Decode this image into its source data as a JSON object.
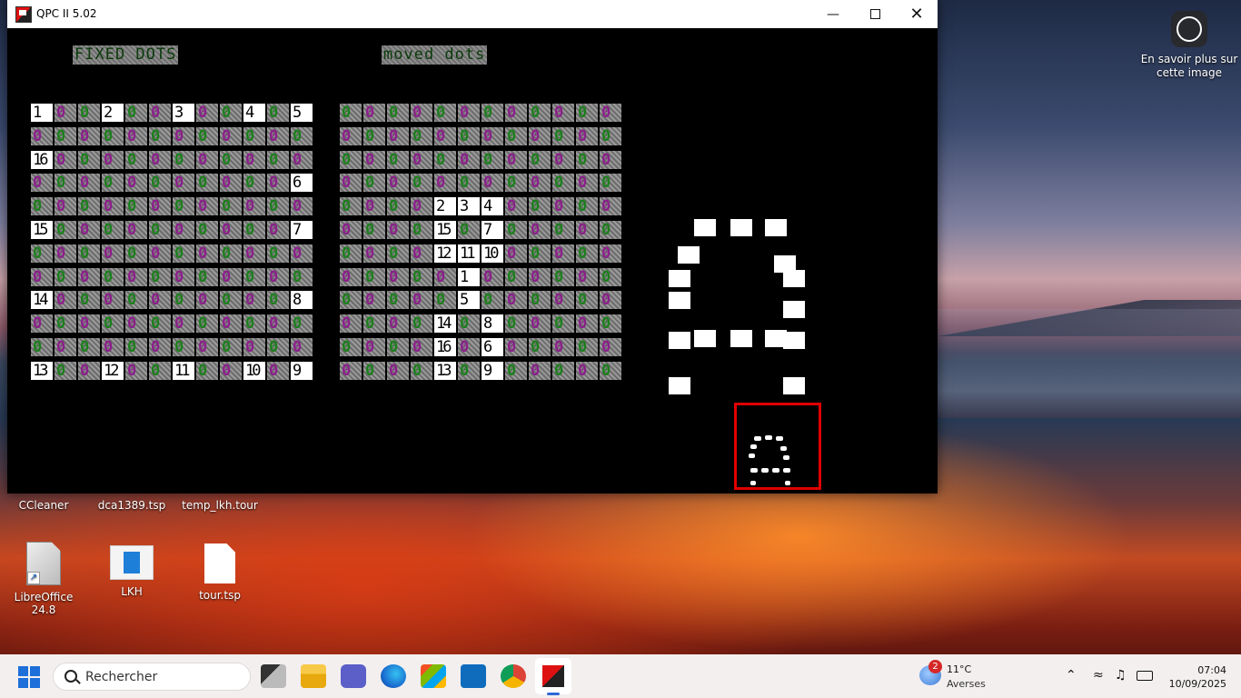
{
  "window": {
    "title": "QPC II 5.02"
  },
  "screen": {
    "left_title": "FIXED DOTS",
    "right_title": "moved dots",
    "fixed_grid": [
      [
        "1",
        "0",
        "0",
        "2",
        "0",
        "0",
        "3",
        "0",
        "0",
        "4",
        "0",
        "5"
      ],
      [
        "0",
        "0",
        "0",
        "0",
        "0",
        "0",
        "0",
        "0",
        "0",
        "0",
        "0",
        "0"
      ],
      [
        "16",
        "0",
        "0",
        "0",
        "0",
        "0",
        "0",
        "0",
        "0",
        "0",
        "0",
        "0"
      ],
      [
        "0",
        "0",
        "0",
        "0",
        "0",
        "0",
        "0",
        "0",
        "0",
        "0",
        "0",
        "6"
      ],
      [
        "0",
        "0",
        "0",
        "0",
        "0",
        "0",
        "0",
        "0",
        "0",
        "0",
        "0",
        "0"
      ],
      [
        "15",
        "0",
        "0",
        "0",
        "0",
        "0",
        "0",
        "0",
        "0",
        "0",
        "0",
        "7"
      ],
      [
        "0",
        "0",
        "0",
        "0",
        "0",
        "0",
        "0",
        "0",
        "0",
        "0",
        "0",
        "0"
      ],
      [
        "0",
        "0",
        "0",
        "0",
        "0",
        "0",
        "0",
        "0",
        "0",
        "0",
        "0",
        "0"
      ],
      [
        "14",
        "0",
        "0",
        "0",
        "0",
        "0",
        "0",
        "0",
        "0",
        "0",
        "0",
        "8"
      ],
      [
        "0",
        "0",
        "0",
        "0",
        "0",
        "0",
        "0",
        "0",
        "0",
        "0",
        "0",
        "0"
      ],
      [
        "0",
        "0",
        "0",
        "0",
        "0",
        "0",
        "0",
        "0",
        "0",
        "0",
        "0",
        "0"
      ],
      [
        "13",
        "0",
        "0",
        "12",
        "0",
        "0",
        "11",
        "0",
        "0",
        "10",
        "0",
        "9"
      ]
    ],
    "moved_grid": [
      [
        "0",
        "0",
        "0",
        "0",
        "0",
        "0",
        "0",
        "0",
        "0",
        "0",
        "0",
        "0"
      ],
      [
        "0",
        "0",
        "0",
        "0",
        "0",
        "0",
        "0",
        "0",
        "0",
        "0",
        "0",
        "0"
      ],
      [
        "0",
        "0",
        "0",
        "0",
        "0",
        "0",
        "0",
        "0",
        "0",
        "0",
        "0",
        "0"
      ],
      [
        "0",
        "0",
        "0",
        "0",
        "0",
        "0",
        "0",
        "0",
        "0",
        "0",
        "0",
        "0"
      ],
      [
        "0",
        "0",
        "0",
        "0",
        "2",
        "3",
        "4",
        "0",
        "0",
        "0",
        "0",
        "0"
      ],
      [
        "0",
        "0",
        "0",
        "0",
        "15",
        "0",
        "7",
        "0",
        "0",
        "0",
        "0",
        "0"
      ],
      [
        "0",
        "0",
        "0",
        "0",
        "12",
        "11",
        "10",
        "0",
        "0",
        "0",
        "0",
        "0"
      ],
      [
        "0",
        "0",
        "0",
        "0",
        "0",
        "1",
        "0",
        "0",
        "0",
        "0",
        "0",
        "0"
      ],
      [
        "0",
        "0",
        "0",
        "0",
        "0",
        "5",
        "0",
        "0",
        "0",
        "0",
        "0",
        "0"
      ],
      [
        "0",
        "0",
        "0",
        "0",
        "14",
        "0",
        "8",
        "0",
        "0",
        "0",
        "0",
        "0"
      ],
      [
        "0",
        "0",
        "0",
        "0",
        "16",
        "0",
        "6",
        "0",
        "0",
        "0",
        "0",
        "0"
      ],
      [
        "0",
        "0",
        "0",
        "0",
        "13",
        "0",
        "9",
        "0",
        "0",
        "0",
        "0",
        "0"
      ]
    ]
  },
  "desktop": {
    "top_labels": [
      "CCleaner",
      "dca1389.tsp",
      "temp_lkh.tour"
    ],
    "icons": [
      "LibreOffice 24.8",
      "LKH",
      "tour.tsp"
    ],
    "lens_text": "En savoir plus sur cette image"
  },
  "taskbar": {
    "search_placeholder": "Rechercher",
    "weather_badge": "2",
    "weather_temp": "11°C",
    "weather_location": "Averses",
    "time": "07:04",
    "date": "10/09/2025"
  },
  "colors": {
    "zero_green": "#1b7f1b",
    "zero_purple": "#8b1e8b",
    "highlight_box": "#e00000"
  }
}
